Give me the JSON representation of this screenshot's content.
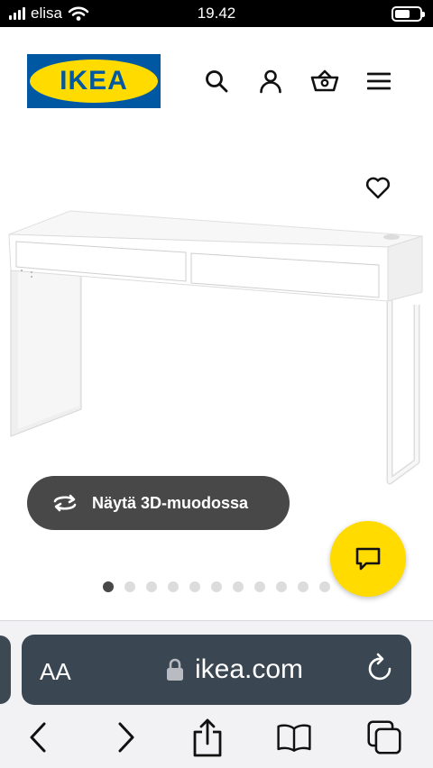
{
  "status_bar": {
    "carrier": "elisa",
    "time": "19.42",
    "battery_level": 0.6
  },
  "header": {
    "logo_text": "IKEA",
    "icons": [
      "search-icon",
      "account-icon",
      "basket-icon",
      "menu-icon"
    ]
  },
  "product": {
    "view_3d_label": "Näytä 3D-muodossa",
    "carousel": {
      "total_images": 11,
      "active_index": 0
    }
  },
  "safari": {
    "text_size_label": "AA",
    "domain": "ikea.com",
    "toolbar_icons": [
      "back-icon",
      "forward-icon",
      "share-icon",
      "bookmarks-icon",
      "tabs-icon"
    ]
  },
  "colors": {
    "ikea_blue": "#0058a3",
    "ikea_yellow": "#ffdb00",
    "button_dark": "#484848",
    "url_bar": "#3a4651"
  }
}
